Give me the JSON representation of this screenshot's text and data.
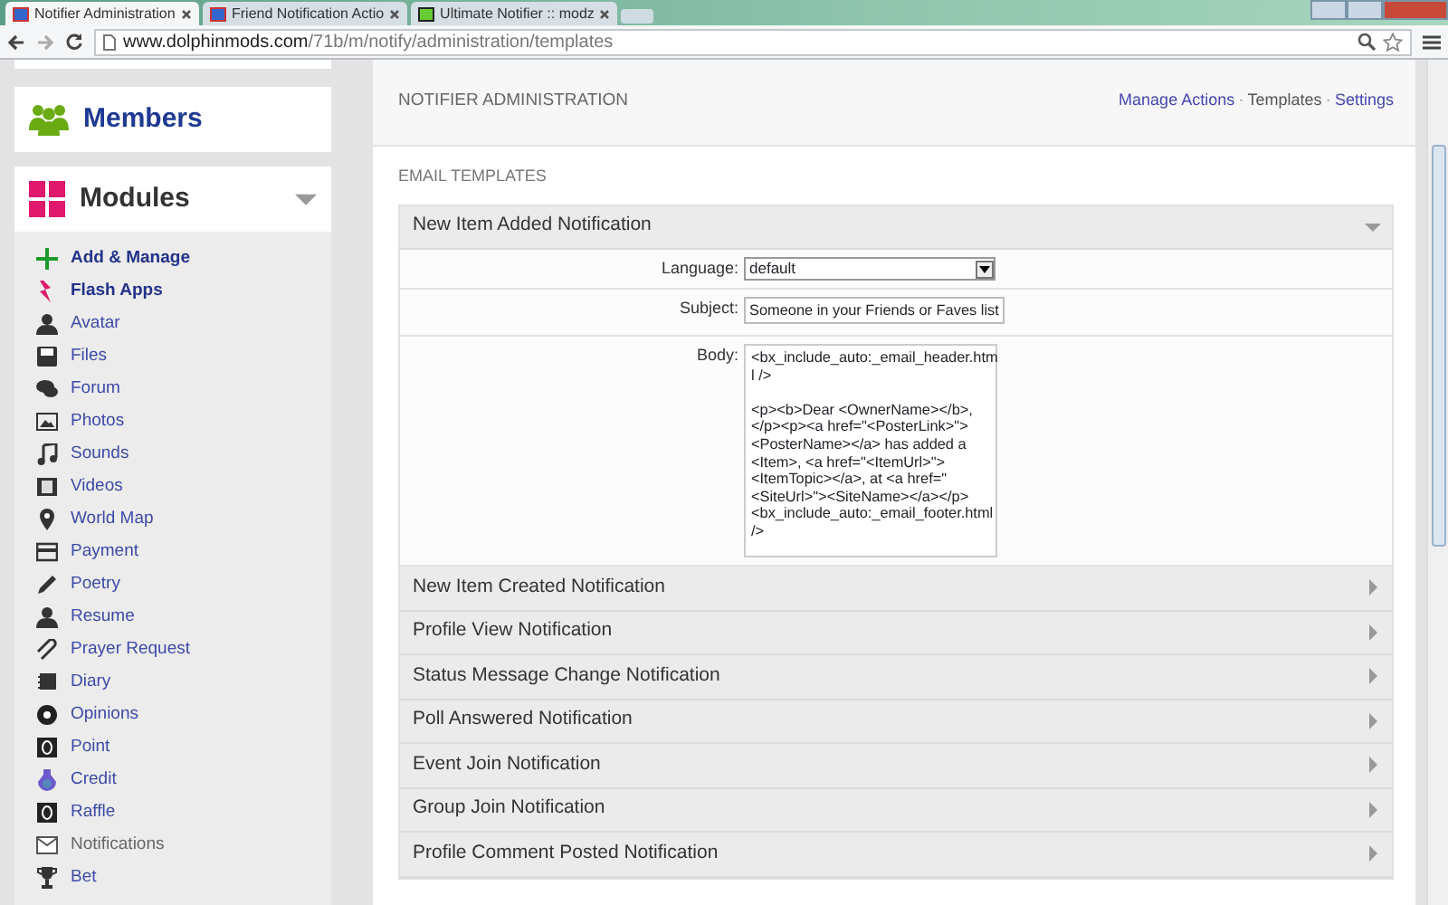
{
  "browser": {
    "tabs": [
      {
        "title": "Notifier Administration",
        "selected": true
      },
      {
        "title": "Friend Notification Actio",
        "selected": false
      },
      {
        "title": "Ultimate Notifier :: modz",
        "selected": false
      }
    ],
    "url_host": "www.dolphinmods.com",
    "url_path": "/71b/m/notify/administration/templates"
  },
  "sidebar": {
    "members_title": "Members",
    "modules_title": "Modules",
    "modules_expanded": true,
    "items": [
      {
        "label": "Add & Manage",
        "kind": "action",
        "selected": false
      },
      {
        "label": "Flash Apps",
        "kind": "action",
        "selected": false
      },
      {
        "label": "Avatar",
        "kind": "module",
        "selected": false
      },
      {
        "label": "Files",
        "kind": "module",
        "selected": false
      },
      {
        "label": "Forum",
        "kind": "module",
        "selected": false
      },
      {
        "label": "Photos",
        "kind": "module",
        "selected": false
      },
      {
        "label": "Sounds",
        "kind": "module",
        "selected": false
      },
      {
        "label": "Videos",
        "kind": "module",
        "selected": false
      },
      {
        "label": "World Map",
        "kind": "module",
        "selected": false
      },
      {
        "label": "Payment",
        "kind": "module",
        "selected": false
      },
      {
        "label": "Poetry",
        "kind": "module",
        "selected": false
      },
      {
        "label": "Resume",
        "kind": "module",
        "selected": false
      },
      {
        "label": "Prayer Request",
        "kind": "module",
        "selected": false
      },
      {
        "label": "Diary",
        "kind": "module",
        "selected": false
      },
      {
        "label": "Opinions",
        "kind": "module",
        "selected": false
      },
      {
        "label": "Point",
        "kind": "module",
        "selected": false
      },
      {
        "label": "Credit",
        "kind": "module",
        "selected": false
      },
      {
        "label": "Raffle",
        "kind": "module",
        "selected": false
      },
      {
        "label": "Notifications",
        "kind": "module",
        "selected": true
      },
      {
        "label": "Bet",
        "kind": "module",
        "selected": false
      }
    ]
  },
  "panel": {
    "title": "NOTIFIER ADMINISTRATION",
    "link_separators": [
      "·",
      "·"
    ],
    "links": [
      {
        "label": "Manage Actions",
        "selected": false
      },
      {
        "label": "Templates",
        "selected": true
      },
      {
        "label": "Settings",
        "selected": false
      }
    ],
    "section_title": "EMAIL TEMPLATES",
    "templates": [
      {
        "title": "New Item Added Notification",
        "expanded": true,
        "language_label": "Language:",
        "language": "default",
        "subject_label": "Subject:",
        "subject": "Someone in your Friends or Faves list",
        "body_label": "Body:",
        "body_paragraphs": [
          [
            "<bx_include_auto:_email_header.htm",
            "l />"
          ],
          [
            "<p><b>Dear <OwnerName></b>,",
            "</p><p><a href=\"<PosterLink>\">",
            "<PosterName></a> has added a",
            "<Item>, <a href=\"<ItemUrl>\">",
            "<ItemTopic></a>, at <a href=\"",
            "<SiteUrl>\"><SiteName></a></p>",
            "<bx_include_auto:_email_footer.html",
            "/>"
          ]
        ]
      },
      {
        "title": "New Item Created Notification",
        "expanded": false
      },
      {
        "title": "Profile View Notification",
        "expanded": false
      },
      {
        "title": "Status Message Change Notification",
        "expanded": false
      },
      {
        "title": "Poll Answered Notification",
        "expanded": false
      },
      {
        "title": "Event Join Notification",
        "expanded": false
      },
      {
        "title": "Group Join Notification",
        "expanded": false
      },
      {
        "title": "Profile Comment Posted Notification",
        "expanded": false
      }
    ]
  }
}
